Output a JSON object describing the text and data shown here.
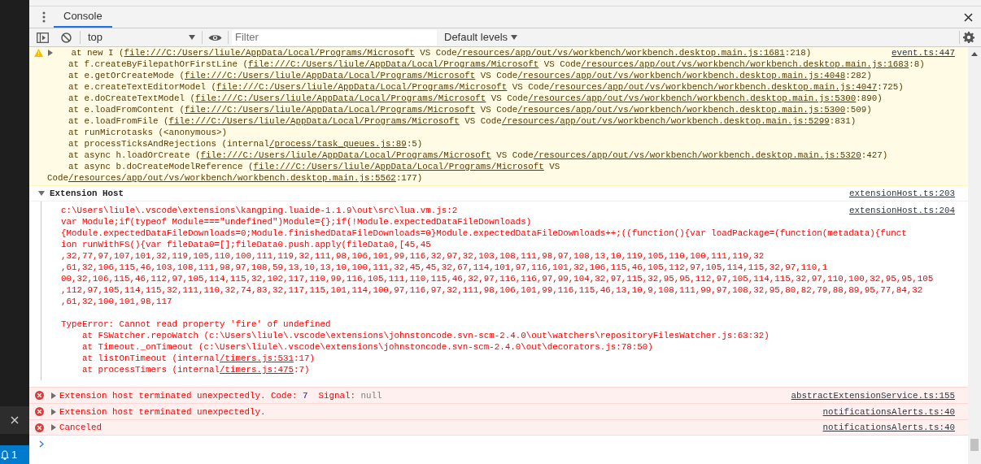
{
  "tabs": [
    {
      "label": "Console",
      "selected": true
    }
  ],
  "toolbar": {
    "context": "top",
    "filter_placeholder": "Filter",
    "levels": "Default levels"
  },
  "messages": [
    {
      "kind": "warning",
      "expanded": false,
      "source": "event.ts:447",
      "lines": [
        [
          "   at new I (",
          "file:///C:/Users/liule/AppData/Local/Programs/Microsoft",
          " VS Code",
          "/resources/app/out/vs/workbench/workbench.desktop.main.js:1681",
          ":218)"
        ],
        [
          "    at f.createByFilepathOrFirstLine (",
          "file:///C:/Users/liule/AppData/Local/Programs/Microsoft",
          " VS Code",
          "/resources/app/out/vs/workbench/workbench.desktop.main.js:1683",
          ":8)"
        ],
        [
          "    at e.getOrCreateMode (",
          "file:///C:/Users/liule/AppData/Local/Programs/Microsoft",
          " VS Code",
          "/resources/app/out/vs/workbench/workbench.desktop.main.js:4048",
          ":282)"
        ],
        [
          "    at e.createTextEditorModel (",
          "file:///C:/Users/liule/AppData/Local/Programs/Microsoft",
          " VS Code",
          "/resources/app/out/vs/workbench/workbench.desktop.main.js:4047",
          ":725)"
        ],
        [
          "    at e.doCreateTextModel (",
          "file:///C:/Users/liule/AppData/Local/Programs/Microsoft",
          " VS Code",
          "/resources/app/out/vs/workbench/workbench.desktop.main.js:5300",
          ":890)"
        ],
        [
          "    at e.loadFromContent (",
          "file:///C:/Users/liule/AppData/Local/Programs/Microsoft",
          " VS Code",
          "/resources/app/out/vs/workbench/workbench.desktop.main.js:5300",
          ":509)"
        ],
        [
          "    at e.loadFromFile (",
          "file:///C:/Users/liule/AppData/Local/Programs/Microsoft",
          " VS Code",
          "/resources/app/out/vs/workbench/workbench.desktop.main.js:5299",
          ":831)"
        ],
        [
          "    at runMicrotasks (<anonymous>)"
        ],
        [
          "    at processTicksAndRejections (internal",
          "/process/task_queues.js:89",
          ":5)"
        ],
        [
          "    at async h.loadOrCreate (",
          "file:///C:/Users/liule/AppData/Local/Programs/Microsoft",
          " VS Code",
          "/resources/app/out/vs/workbench/workbench.desktop.main.js:5320",
          ":427)"
        ],
        [
          "    at async b.doCreateModelReference (",
          "file:///C:/Users/liule/AppData/Local/Programs/Microsoft",
          " VS Code",
          "/resources/app/out/vs/workbench/workbench.desktop.main.js:5562",
          ":177)"
        ]
      ]
    },
    {
      "kind": "group",
      "expanded": true,
      "title": "Extension Host",
      "source": "extensionHost.ts:203",
      "children": [
        {
          "kind": "error-text",
          "source": "extensionHost.ts:204",
          "paragraphs": [
            [
              [
                "c:\\Users\\liule\\.vscode\\extensions\\kangping.luaide-1.1.9\\out\\src\\lua.vm.js:2"
              ],
              [
                "var Module;if(typeof Module===\"undefined\")Module={};if(!Module.expectedDataFileDownloads)"
              ],
              [
                "{Module.expectedDataFileDownloads=0;Module.finishedDataFileDownloads=0}Module.expectedDataFileDownloads++;((function(){var loadPackage=(function(metadata){funct"
              ],
              [
                "ion runWithFS(){var fileData0=[];fileData0.push.apply(fileData0,[45,45"
              ],
              [
                ",32,77,97,107,101,32,119,105,110,100,111,119,32,111,98,106,101,99,116,32,97,32,103,108,111,98,97,108,13,10,119,105,110,100,111,119,32"
              ],
              [
                ",61,32,106,115,46,103,108,111,98,97,108,59,13,10,13,10,100,111,32,45,45,32,67,114,101,97,116,101,32,106,115,46,105,112,97,105,114,115,32,97,110,1"
              ],
              [
                "00,32,106,115,46,112,97,105,114,115,32,102,117,110,99,116,105,111,110,115,46,32,97,116,116,97,99,104,32,97,115,32,95,95,112,97,105,114,115,32,97,110,100,32,95,95,105"
              ],
              [
                ",112,97,105,114,115,32,111,110,32,74,83,32,117,115,101,114,100,97,116,97,32,111,98,106,101,99,116,115,46,13,10,9,108,111,99,97,108,32,95,80,82,79,88,89,95,77,84,32"
              ],
              [
                ",61,32,100,101,98,117"
              ]
            ],
            [
              [
                "TypeError: Cannot read property 'fire' of undefined"
              ],
              [
                "    at FSWatcher.repoWatch (c:\\Users\\liule\\.vscode\\extensions\\johnstoncode.svn-scm-2.4.0\\out\\watchers\\repositoryFilesWatcher.js:63:32)"
              ],
              [
                "    at Timeout._onTimeout (c:\\Users\\liule\\.vscode\\extensions\\johnstoncode.svn-scm-2.4.0\\out\\decorators.js:78:50)"
              ],
              [
                "    at listOnTimeout (internal",
                "/timers.js:531",
                ":17)"
              ],
              [
                "    at processTimers (internal",
                "/timers.js:475",
                ":7)"
              ]
            ]
          ]
        }
      ]
    },
    {
      "kind": "error",
      "expanded": false,
      "source": "abstractExtensionService.ts:155",
      "parts": [
        {
          "kind": "text",
          "text": "Extension host terminated unexpectedly. Code: "
        },
        {
          "kind": "number",
          "text": "7"
        },
        {
          "kind": "text",
          "text": "  Signal: "
        },
        {
          "kind": "null",
          "text": "null"
        }
      ]
    },
    {
      "kind": "error",
      "expanded": false,
      "source": "notificationsAlerts.ts:40",
      "parts": [
        {
          "kind": "text",
          "text": "Extension host terminated unexpectedly."
        }
      ]
    },
    {
      "kind": "error",
      "expanded": false,
      "source": "notificationsAlerts.ts:40",
      "parts": [
        {
          "kind": "text",
          "text": "Canceled"
        }
      ]
    }
  ],
  "host_window": {
    "notification_count": "1"
  }
}
